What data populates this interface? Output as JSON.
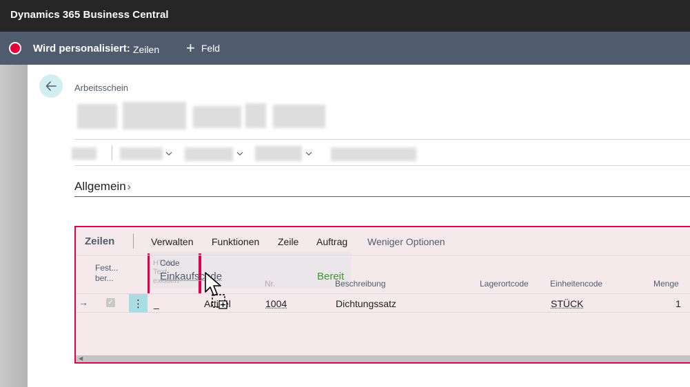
{
  "titlebar": {
    "app_name": "Dynamics 365 Business Central"
  },
  "personalization": {
    "label": "Wird personalisiert:",
    "target": "Zeilen",
    "add_field_label": "Feld"
  },
  "page": {
    "breadcrumb": "Arbeitsschein",
    "section_title": "Allgemein"
  },
  "lines": {
    "title": "Zeilen",
    "actions": [
      "Verwalten",
      "Funktionen",
      "Zeile",
      "Auftrag"
    ],
    "less_options": "Weniger Optionen",
    "headers": {
      "fest_line1": "Fest...",
      "fest_line2": "ber...",
      "ghost_line1": "HTML",
      "ghost_line2": "Text",
      "ghost_line3": "existiert",
      "nr": "Nr.",
      "beschreibung": "Beschreibung",
      "lagerortcode": "Lagerortcode",
      "einheitencode": "Einheitencode",
      "menge": "Menge"
    },
    "drag": {
      "code": "Code",
      "name": "Einkaufscode",
      "status": "Bereit"
    },
    "row": {
      "col3": "_",
      "type": "Artikel",
      "nr": "1004",
      "beschreibung": "Dichtungssatz",
      "lagerortcode": "",
      "einheitencode": "STÜCK",
      "menge": "1"
    }
  },
  "colors": {
    "accent": "#e0004f",
    "titlebar": "#262626",
    "personbar": "#505c6d",
    "ready": "#3c9a2e",
    "row_menu": "#a9dde3"
  }
}
